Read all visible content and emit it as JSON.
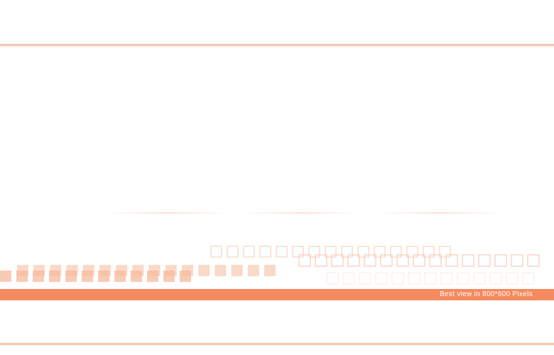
{
  "footer": {
    "notice": "Best view in 800*600 Pixels"
  },
  "colors": {
    "accent": "#f58a5e",
    "rule": "#e9a47b",
    "square_fill": "#f5b99c",
    "square_outline": "#f2c2ab"
  }
}
